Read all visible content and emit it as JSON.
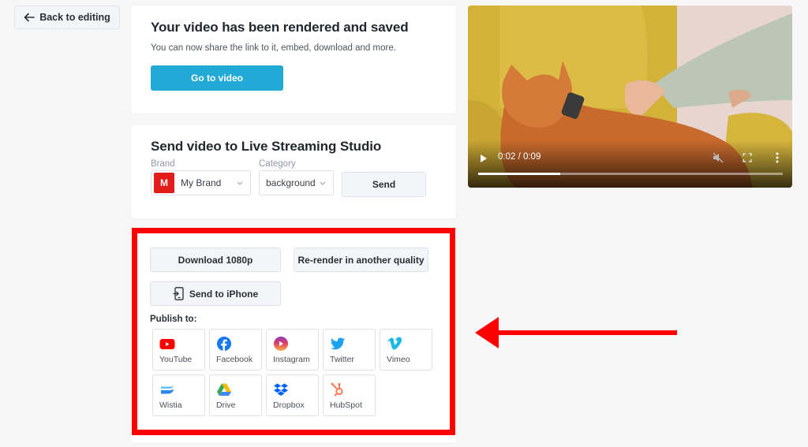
{
  "back_button": {
    "label": "Back to editing",
    "icon": "arrow-left-icon"
  },
  "rendered_card": {
    "title": "Your video has been rendered and saved",
    "subtitle": "You can now share the link to it, embed, download and more.",
    "go_button": "Go to video",
    "accent_color": "#22aad6"
  },
  "stream_card": {
    "title": "Send video to Live Streaming Studio",
    "brand": {
      "label": "Brand",
      "value": "My Brand",
      "badge_letter": "M",
      "badge_color": "#e41b1b"
    },
    "category": {
      "label": "Category",
      "value": "background"
    },
    "send_button": "Send"
  },
  "actions_card": {
    "download_button": "Download 1080p",
    "rerender_button": "Re-render in another quality",
    "iphone_button": "Send to iPhone",
    "publish_label": "Publish to:",
    "platforms": [
      {
        "name": "YouTube",
        "icon": "youtube-icon",
        "color": "#ff0000"
      },
      {
        "name": "Facebook",
        "icon": "facebook-icon",
        "color": "#1877f2"
      },
      {
        "name": "Instagram",
        "icon": "instagram-icon",
        "color": "#c13584"
      },
      {
        "name": "Twitter",
        "icon": "twitter-icon",
        "color": "#1da1f2"
      },
      {
        "name": "Vimeo",
        "icon": "vimeo-icon",
        "color": "#1ab7ea"
      },
      {
        "name": "Wistia",
        "icon": "wistia-icon",
        "color": "#2a86e8"
      },
      {
        "name": "Drive",
        "icon": "google-drive-icon",
        "color": "#34a853"
      },
      {
        "name": "Dropbox",
        "icon": "dropbox-icon",
        "color": "#0061ff"
      },
      {
        "name": "HubSpot",
        "icon": "hubspot-icon",
        "color": "#ff7a59"
      }
    ]
  },
  "annotation": {
    "highlight_color": "#ff0000"
  },
  "video_player": {
    "current_time": "0:02",
    "duration": "0:09",
    "time_display": "0:02 / 0:09",
    "progress_fraction": 0.27,
    "muted": true
  }
}
